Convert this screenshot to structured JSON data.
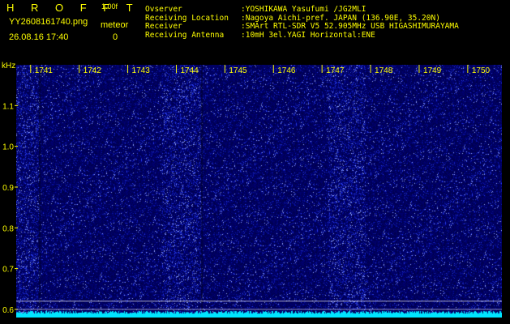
{
  "header": {
    "brand": "H R O F F T",
    "version": "1.00f",
    "filename": "YY2608161740.png",
    "datetime": "26.08.16 17:40",
    "meteor_label": "meteor",
    "meteor_count": "0"
  },
  "station": {
    "rows": [
      {
        "key": "Ovserver",
        "value": ":YOSHIKAWA Yasufumi /JG2MLI"
      },
      {
        "key": "Receiving Location",
        "value": ":Nagoya Aichi-pref. JAPAN (136.90E, 35.20N)"
      },
      {
        "key": "Receiver",
        "value": ":SMArt RTL-SDR V5 52.905MHz USB HIGASHIMURAYAMA"
      },
      {
        "key": "Receiving Antenna",
        "value": ":10mH 3el.YAGI Horizontal:ENE"
      }
    ]
  },
  "colors": {
    "text": "#ffff00",
    "background": "#000000",
    "waterfall_base": "#000066",
    "noise_floor": "#00e5ff",
    "grid": "#ffffff"
  },
  "chart_data": {
    "type": "heatmap",
    "ylabel": "kHz",
    "yticks": [
      0.6,
      0.7,
      0.8,
      0.9,
      1.0,
      1.1
    ],
    "ylim": [
      0.58,
      1.2
    ],
    "xticks": [
      "1741",
      "1742",
      "1743",
      "1744",
      "1745",
      "1746",
      "1747",
      "1748",
      "1749",
      "1750"
    ],
    "xlim_minutes": [
      0,
      10
    ],
    "horizontal_reference_lines_khz": [
      0.62,
      0.6
    ],
    "grid": false
  }
}
